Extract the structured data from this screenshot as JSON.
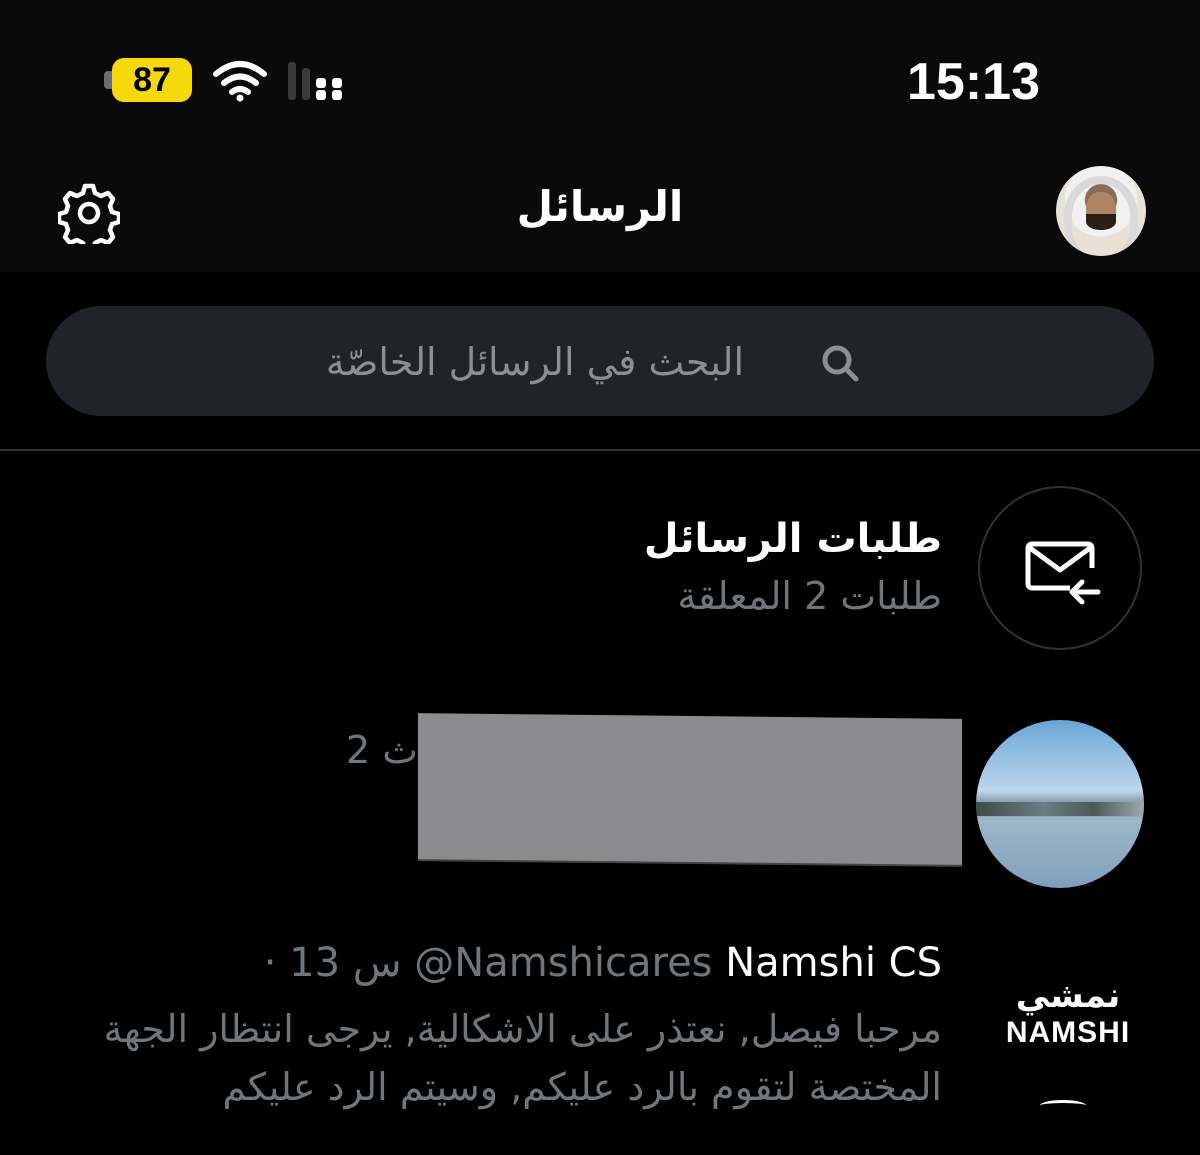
{
  "status_bar": {
    "battery": "87",
    "time": "15:13"
  },
  "header": {
    "title": "الرسائل"
  },
  "search": {
    "placeholder": "البحث في الرسائل الخاصّة"
  },
  "message_requests": {
    "title": "طلبات الرسائل",
    "subtitle": "طلبات 2 المعلقة"
  },
  "conversations": [
    {
      "time": "2 ث"
    },
    {
      "name": "Namshi CS",
      "handle": "@Namshicares",
      "time": "· 13 س",
      "preview": "مرحبا فيصل, نعتذر على الاشكالية, يرجى انتظار الجهة المختصة لتقوم بالرد عليكم, وسيتم الرد عليكم",
      "logo_ar": "نمشي",
      "logo_en": "NAMSHI"
    }
  ],
  "colors": {
    "background": "#000000",
    "secondary_text": "#71767b",
    "battery": "#f5d90a"
  }
}
